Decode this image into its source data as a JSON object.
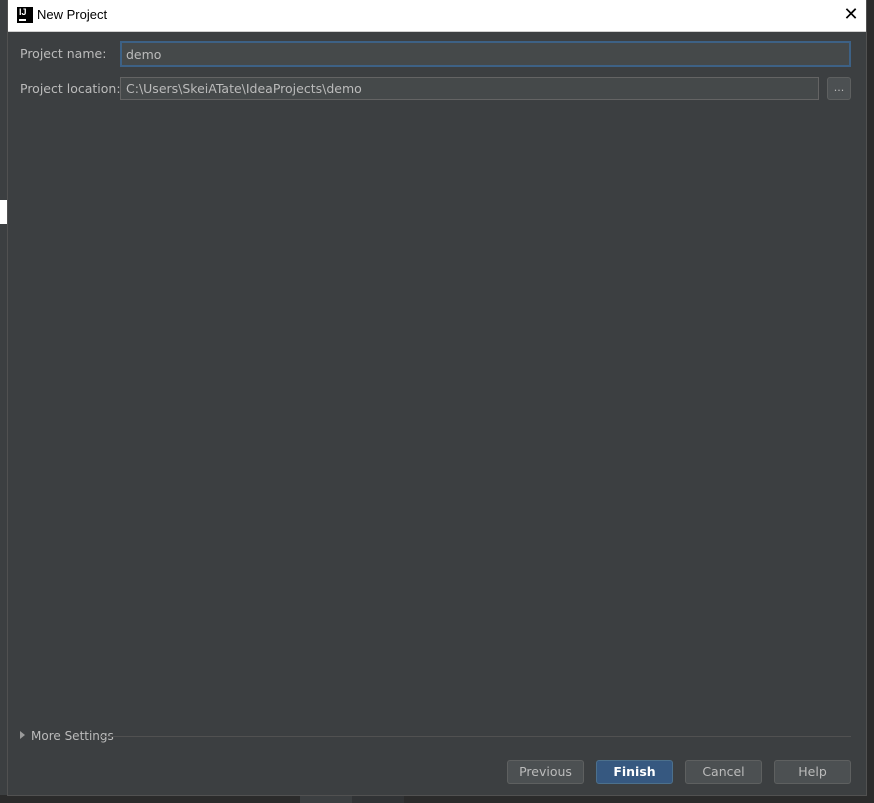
{
  "window": {
    "title": "New Project",
    "close_glyph": "✕"
  },
  "form": {
    "project_name_label": "Project name:",
    "project_name_value": "demo",
    "project_location_label": "Project location:",
    "project_location_value": "C:\\Users\\SkeiATate\\IdeaProjects\\demo",
    "browse_label": "..."
  },
  "more_settings": {
    "label": "More Settings"
  },
  "buttons": {
    "previous": "Previous",
    "finish": "Finish",
    "cancel": "Cancel",
    "help": "Help"
  },
  "icons": {
    "app": "intellij-idea-icon",
    "close": "close-icon",
    "expand": "triangle-right-icon"
  },
  "colors": {
    "dialog_bg": "#3c3f41",
    "input_bg": "#45494a",
    "focus_border": "#3d6185",
    "primary_button": "#365880",
    "text": "#bbbbbb"
  }
}
